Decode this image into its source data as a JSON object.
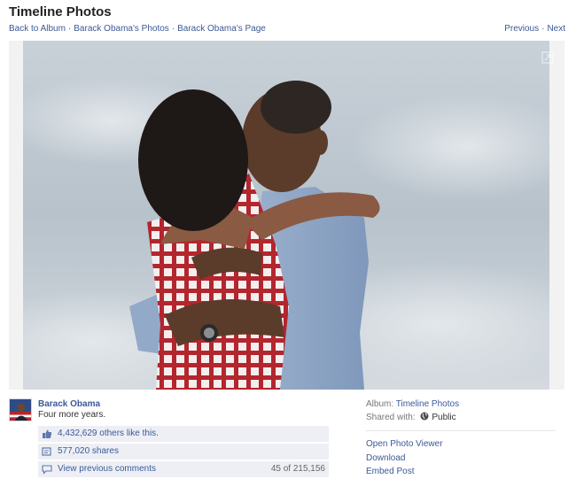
{
  "header": {
    "title": "Timeline Photos",
    "breadcrumbs": [
      "Back to Album",
      "Barack Obama's Photos",
      "Barack Obama's Page"
    ],
    "separator": "·",
    "previous": "Previous",
    "next": "Next"
  },
  "post": {
    "author": "Barack Obama",
    "caption": "Four more years.",
    "likes_text": "4,432,629 others like this.",
    "shares_text": "577,020 shares",
    "comments_link": "View previous comments",
    "comments_count": "45 of 215,156"
  },
  "meta": {
    "album_label": "Album:",
    "album_name": "Timeline Photos",
    "shared_label": "Shared with:",
    "privacy": "Public"
  },
  "actions": {
    "open_viewer": "Open Photo Viewer",
    "download": "Download",
    "embed": "Embed Post"
  },
  "icons": {
    "expand": "expand-icon",
    "like": "thumbs-up-icon",
    "share": "share-icon",
    "comment": "comment-bubble-icon",
    "privacy": "globe-icon"
  },
  "colors": {
    "link": "#3b5998",
    "ufi_background": "#edeff4",
    "stage": "#f2f2f2"
  }
}
